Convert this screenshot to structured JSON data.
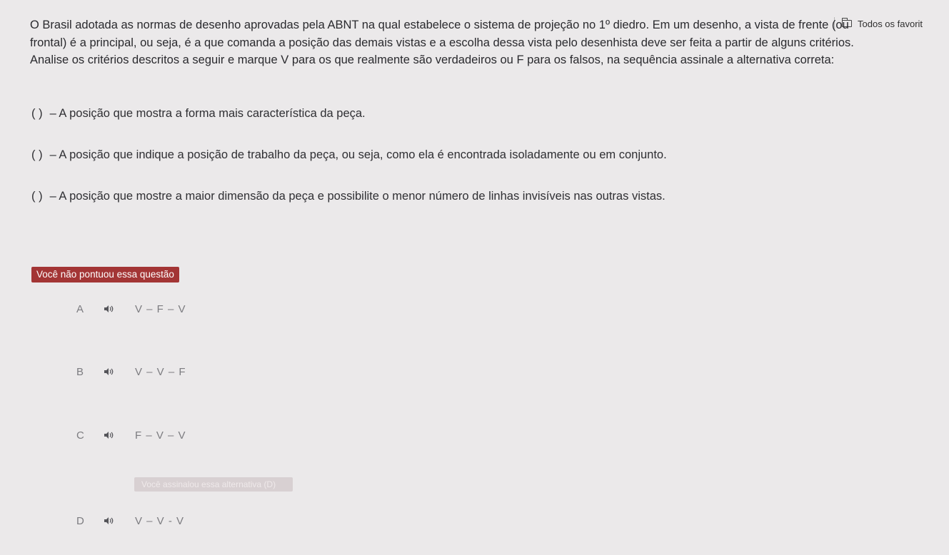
{
  "bookmarks_bar": {
    "folder_label": "Todos os favorit"
  },
  "question": {
    "lines": [
      "O Brasil adotada as normas de desenho aprovadas pela ABNT na qual estabelece o sistema de projeção no 1º diedro. Em um desenho, a vista de frente (ou",
      "frontal) é a principal, ou seja, é a que comanda a posição das demais vistas e a escolha dessa vista pelo desenhista deve ser feita a partir de alguns critérios.",
      "Analise os critérios descritos a seguir e marque V para os que realmente são verdadeiros ou F para os falsos, na sequência assinale a alternativa correta:"
    ]
  },
  "criteria": [
    {
      "box": "(  )",
      "text": "– A posição que mostra a forma mais característica da peça."
    },
    {
      "box": "(  )",
      "text": "– A posição que indique a posição de trabalho da peça, ou seja, como ela é encontrada isoladamente ou em conjunto."
    },
    {
      "box": "(  )",
      "text": "– A posição que mostre a maior dimensão da peça e possibilite o menor número de linhas invisíveis nas outras vistas."
    }
  ],
  "result_badge": "Você não pontuou essa questão",
  "options": [
    {
      "letter": "A",
      "value": "V – F – V",
      "icon": "speaker-icon"
    },
    {
      "letter": "B",
      "value": "V – V – F",
      "icon": "speaker-icon"
    },
    {
      "letter": "C",
      "value": "F – V – V",
      "icon": "speaker-icon"
    },
    {
      "letter": "D",
      "value": "V – V - V",
      "icon": "speaker-icon"
    }
  ],
  "selected_badge": "Você assinalou essa alternativa (D)",
  "colors": {
    "badge": "#a33535",
    "background": "#ebe9ea",
    "text": "#2b2b2e",
    "option_text": "#7c7c80"
  }
}
